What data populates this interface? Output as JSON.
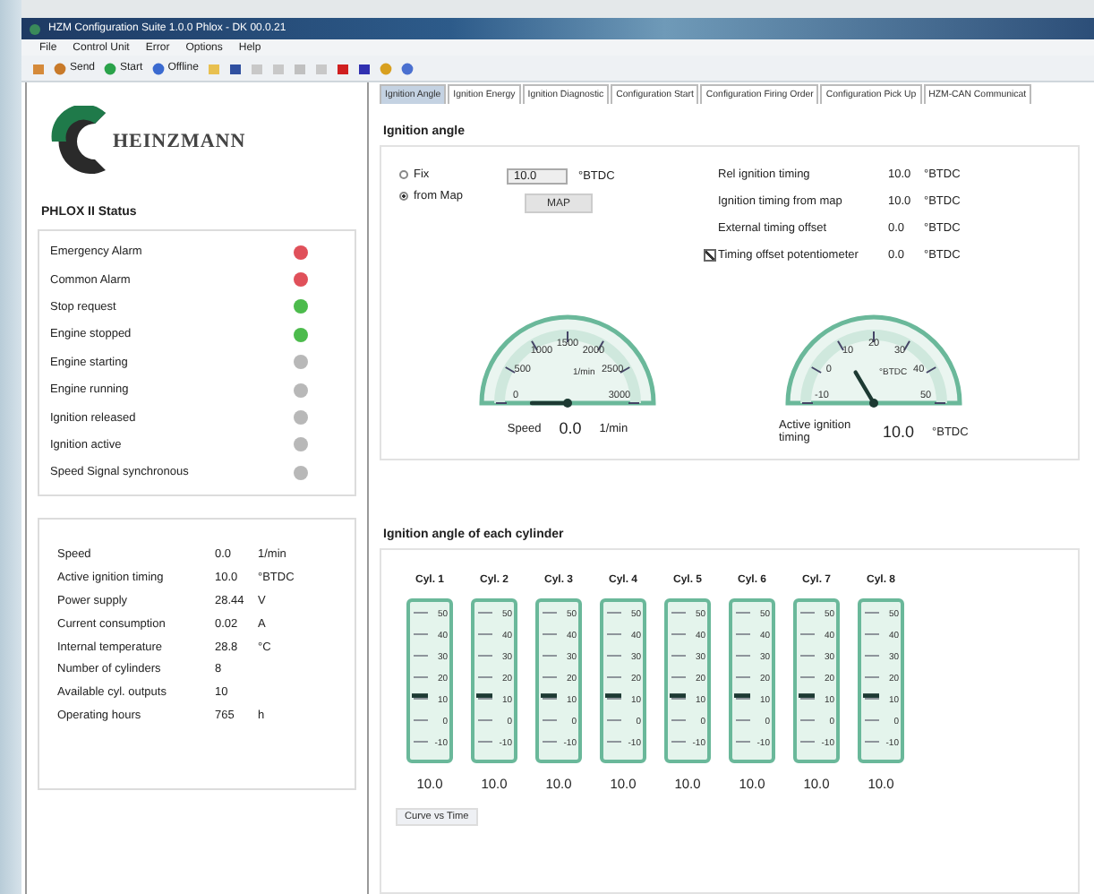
{
  "window": {
    "title": "HZM Configuration Suite 1.0.0 Phlox - DK 00.0.21"
  },
  "menu": [
    "File",
    "Control Unit",
    "Error",
    "Options",
    "Help"
  ],
  "toolbar": [
    {
      "kind": "send",
      "label": "Send"
    },
    {
      "kind": "start",
      "label": "Start"
    },
    {
      "kind": "offline",
      "label": "Offline"
    }
  ],
  "sidebar": {
    "logo": "HEINZMANN",
    "status_title": "PHLOX II Status",
    "status": [
      {
        "label": "Emergency Alarm",
        "color": "#e0505a"
      },
      {
        "label": "Common Alarm",
        "color": "#e0505a"
      },
      {
        "label": "Stop request",
        "color": "#4cbb4c"
      },
      {
        "label": "Engine stopped",
        "color": "#4cbb4c"
      },
      {
        "label": "Engine starting",
        "color": "#b8b8b8"
      },
      {
        "label": "Engine running",
        "color": "#b8b8b8"
      },
      {
        "label": "Ignition released",
        "color": "#b8b8b8"
      },
      {
        "label": "Ignition active",
        "color": "#b8b8b8"
      },
      {
        "label": "Speed Signal synchronous",
        "color": "#b8b8b8"
      }
    ],
    "readings": [
      {
        "label": "Speed",
        "value": "0.0",
        "unit": "1/min"
      },
      {
        "label": "Active ignition timing",
        "value": "10.0",
        "unit": "°BTDC"
      },
      {
        "label": "Power supply",
        "value": "28.44",
        "unit": "V"
      },
      {
        "label": "Current consumption",
        "value": "0.02",
        "unit": "A"
      },
      {
        "label": "Internal temperature",
        "value": "28.8",
        "unit": "°C"
      },
      {
        "label": "Number of cylinders",
        "value": "8"
      },
      {
        "label": "Available cyl. outputs",
        "value": "10"
      },
      {
        "label": "Operating hours",
        "value": "765",
        "unit": "h"
      }
    ]
  },
  "tabs": [
    {
      "label": "Ignition Angle",
      "selected": true
    },
    {
      "label": "Ignition Energy",
      "selected": false
    },
    {
      "label": "Ignition Diagnostic",
      "selected": false
    },
    {
      "label": "Configuration Start",
      "selected": false
    },
    {
      "label": "Configuration Firing Order",
      "selected": false
    },
    {
      "label": "Configuration Pick Up",
      "selected": false
    },
    {
      "label": "HZM-CAN Communicat",
      "selected": false
    }
  ],
  "ignition_angle": {
    "title": "Ignition angle",
    "modes": [
      {
        "label": "Fix",
        "selected": false
      },
      {
        "label": "from Map",
        "selected": true
      }
    ],
    "fix_value": "10.0",
    "fix_unit": "°BTDC",
    "map_button": "MAP",
    "timings": [
      {
        "label": "Rel ignition timing",
        "value": "10.0",
        "unit": "°BTDC"
      },
      {
        "label": "Ignition timing from map",
        "value": "10.0",
        "unit": "°BTDC"
      },
      {
        "label": "External timing offset",
        "value": "0.0",
        "unit": "°BTDC"
      },
      {
        "kind": "checkbox",
        "checked": true,
        "label": "Timing offset potentiometer",
        "value": "0.0",
        "unit": "°BTDC"
      }
    ],
    "gauges": [
      {
        "ticks": [
          "0",
          "500",
          "1000",
          "1500",
          "2000",
          "2500",
          "3000"
        ],
        "center_label": "1/min",
        "label": "Speed",
        "value": "0.0",
        "unit": "1/min"
      },
      {
        "ticks": [
          "-10",
          "0",
          "10",
          "20",
          "30",
          "40",
          "50"
        ],
        "center_label": "°BTDC",
        "label": "Active ignition timing",
        "value": "10.0",
        "unit": "°BTDC"
      }
    ]
  },
  "cylinders": {
    "title": "Ignition angle of each cylinder",
    "items": [
      {
        "name": "Cyl. 1",
        "scale": [
          "50",
          "40",
          "30",
          "20",
          "10",
          "0",
          "-10"
        ],
        "level": 0.36,
        "value": "10.0"
      },
      {
        "name": "Cyl. 2",
        "scale": [
          "50",
          "40",
          "30",
          "20",
          "10",
          "0",
          "-10"
        ],
        "level": 0.36,
        "value": "10.0"
      },
      {
        "name": "Cyl. 3",
        "scale": [
          "50",
          "40",
          "30",
          "20",
          "10",
          "0",
          "-10"
        ],
        "level": 0.36,
        "value": "10.0"
      },
      {
        "name": "Cyl. 4",
        "scale": [
          "50",
          "40",
          "30",
          "20",
          "10",
          "0",
          "-10"
        ],
        "level": 0.36,
        "value": "10.0"
      },
      {
        "name": "Cyl. 5",
        "scale": [
          "50",
          "40",
          "30",
          "20",
          "10",
          "0",
          "-10"
        ],
        "level": 0.36,
        "value": "10.0"
      },
      {
        "name": "Cyl. 6",
        "scale": [
          "50",
          "40",
          "30",
          "20",
          "10",
          "0",
          "-10"
        ],
        "level": 0.36,
        "value": "10.0"
      },
      {
        "name": "Cyl. 7",
        "scale": [
          "50",
          "40",
          "30",
          "20",
          "10",
          "0",
          "-10"
        ],
        "level": 0.36,
        "value": "10.0"
      },
      {
        "name": "Cyl. 8",
        "scale": [
          "50",
          "40",
          "30",
          "20",
          "10",
          "0",
          "-10"
        ],
        "level": 0.36,
        "value": "10.0"
      }
    ],
    "button": "Curve vs Time"
  }
}
